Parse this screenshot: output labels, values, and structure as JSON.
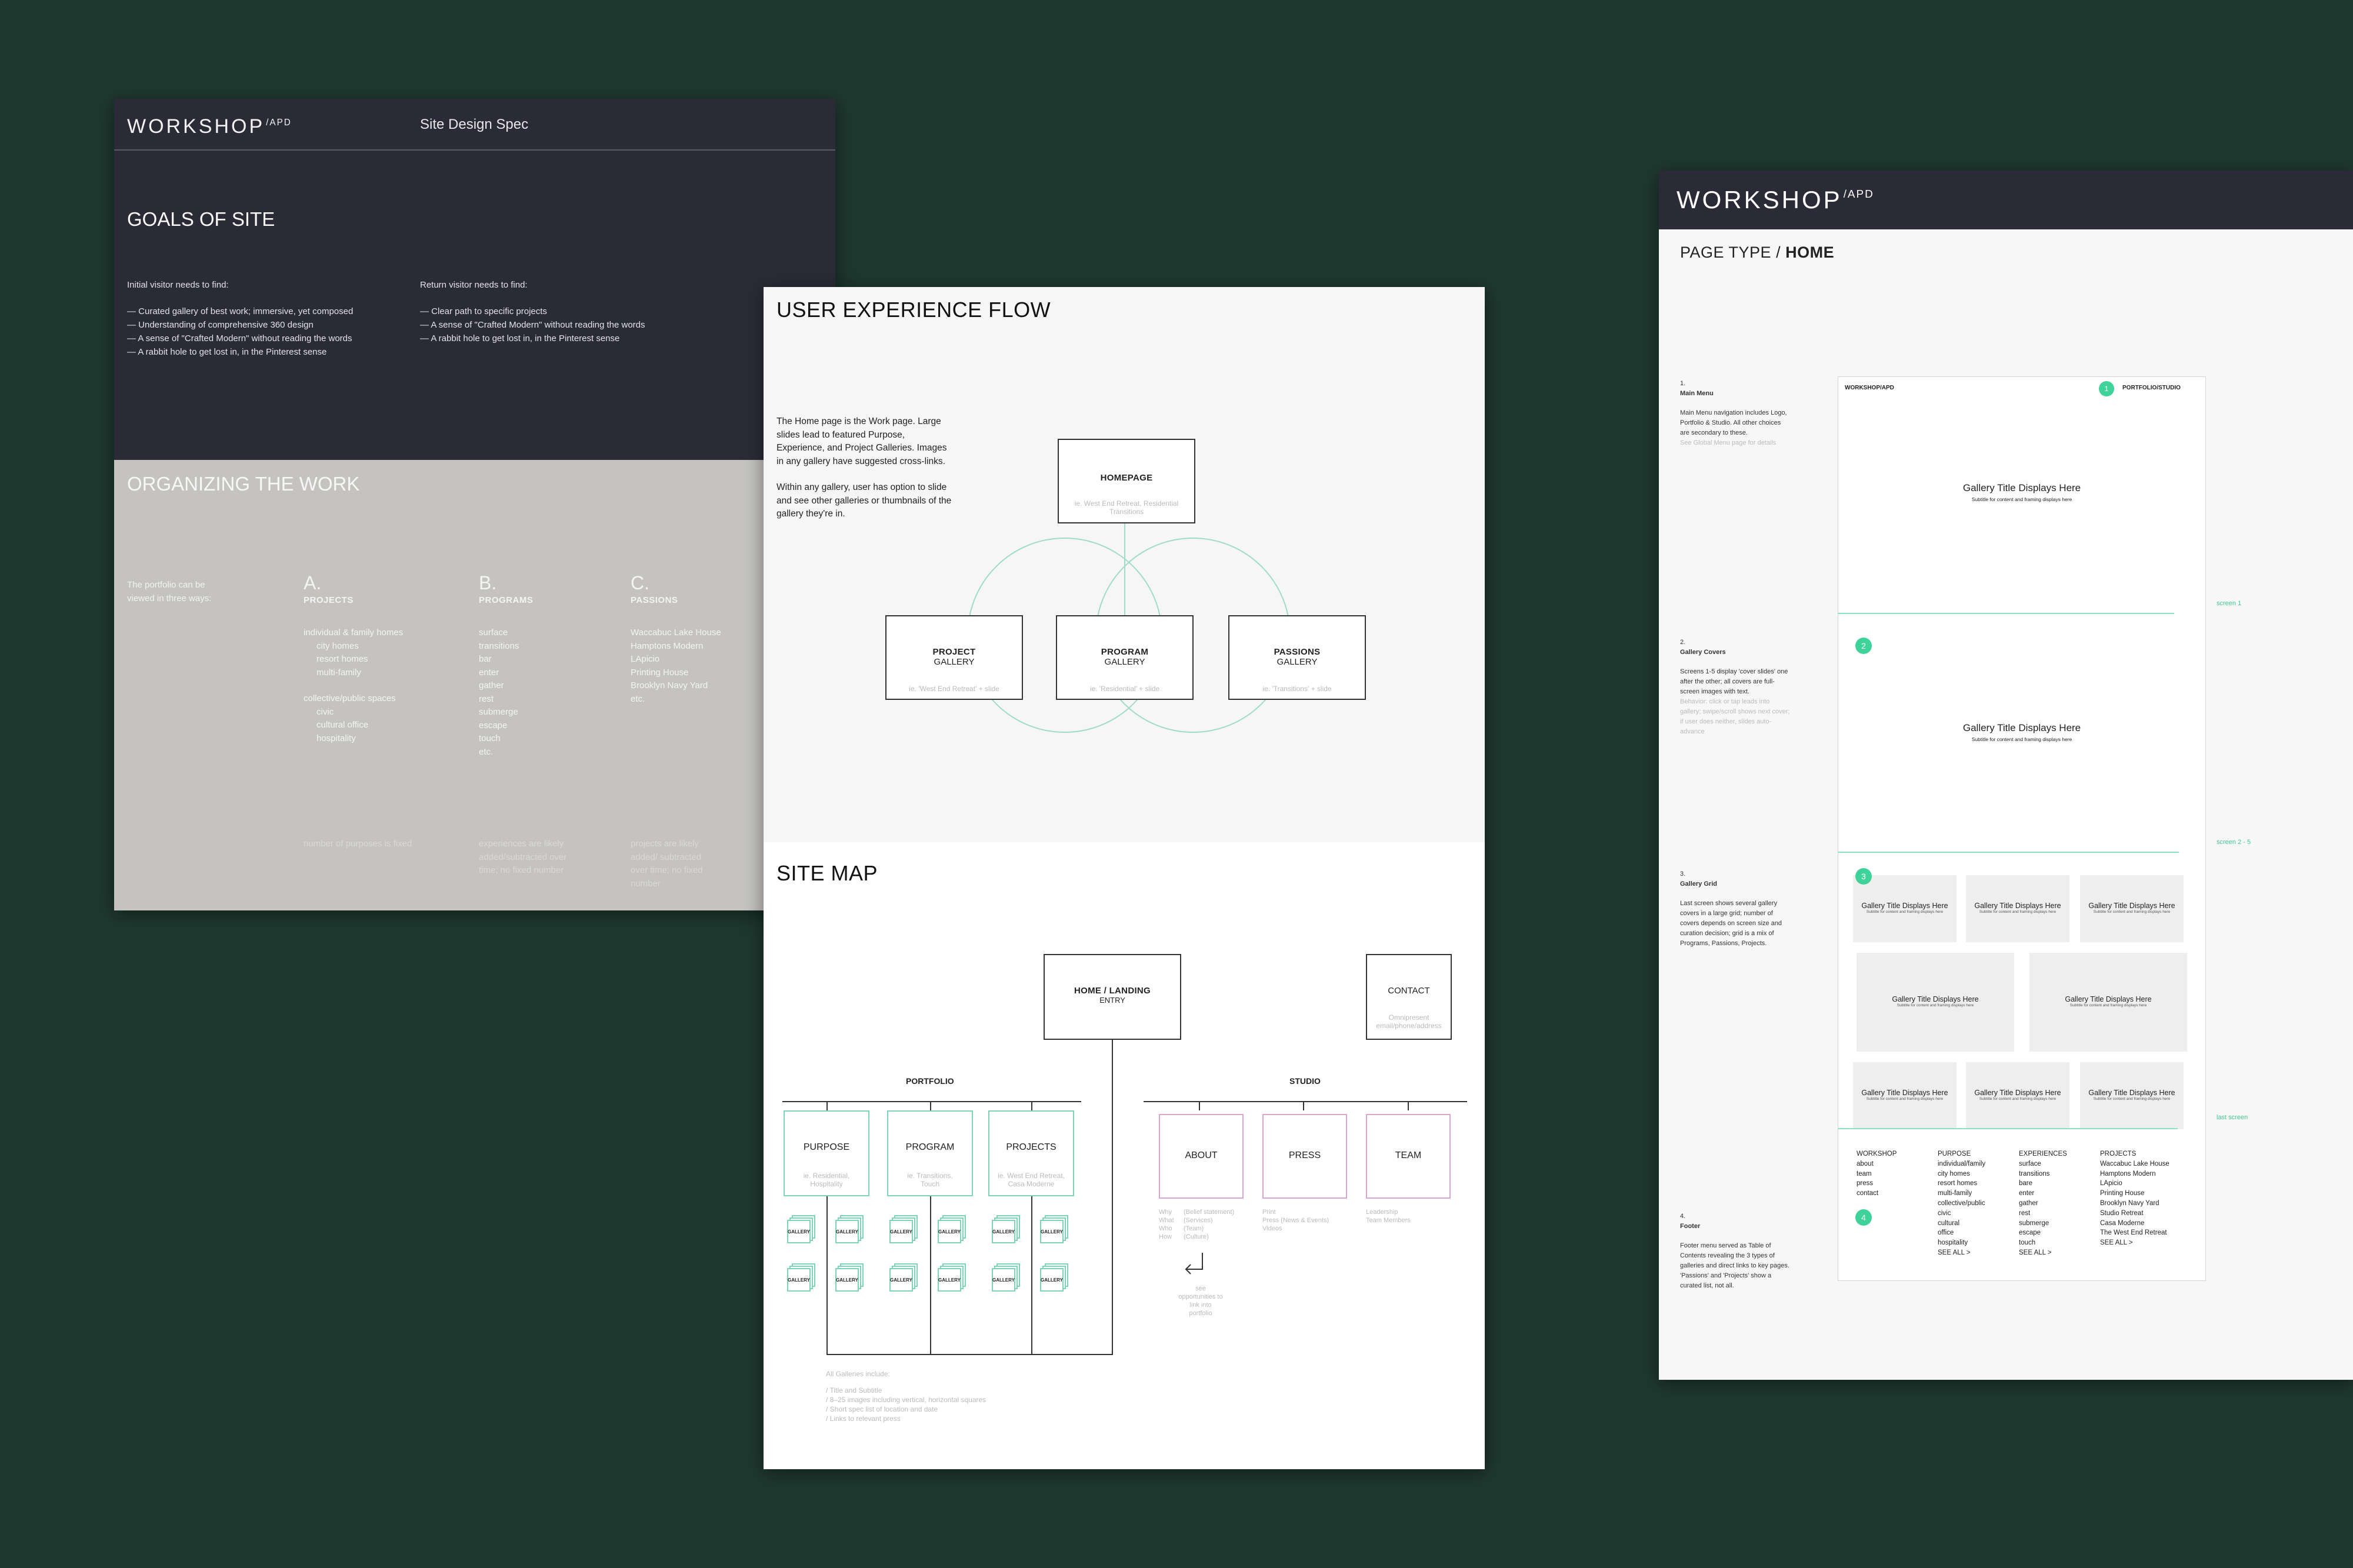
{
  "sheet1": {
    "logo": "WORKSHOP",
    "logo_sup": "/APD",
    "subtitle": "Site Design Spec",
    "goals_title": "GOALS OF SITE",
    "initial_head": "Initial visitor needs to find:",
    "initial_items": [
      "— Curated gallery of best work; immersive, yet composed",
      "— Understanding of comprehensive 360 design",
      "— A sense of \"Crafted Modern\" without reading the words",
      "— A rabbit hole to get lost in, in the Pinterest sense"
    ],
    "return_head": "Return visitor needs to find:",
    "return_items": [
      "— Clear path to specific projects",
      "— A sense of \"Crafted Modern\" without reading the words",
      "— A rabbit hole to get lost in, in the Pinterest sense"
    ],
    "org_title": "ORGANIZING THE WORK",
    "viewed": "The portfolio can be viewed in three ways:",
    "cat_a": {
      "letter": "A.",
      "title": "PROJECTS",
      "items": [
        "individual & family homes",
        "city homes",
        "resort homes",
        "multi-family",
        "collective/public spaces",
        "civic",
        "cultural office",
        "hospitality"
      ]
    },
    "cat_b": {
      "letter": "B.",
      "title": "PROGRAMS",
      "items": [
        "surface",
        "transitions",
        "bar",
        "enter",
        "gather",
        "rest",
        "submerge",
        "escape",
        "touch",
        "etc."
      ]
    },
    "cat_c": {
      "letter": "C.",
      "title": "PASSIONS",
      "items": [
        "Waccabuc Lake House",
        "Hamptons Modern",
        "LApicio",
        "Printing House",
        "Brooklyn Navy Yard",
        "etc."
      ]
    },
    "note_a": "number of purposes is fixed",
    "note_b": "experiences are likely added/subtracted over time; no fixed number",
    "note_c": "projects are likely added/ subtracted over time; no fixed number"
  },
  "sheet2": {
    "ux_title": "USER EXPERIENCE FLOW",
    "ux_p1": "The Home page is the Work page. Large slides lead to featured Purpose, Experience, and Project Galleries. Images in any gallery have suggested cross-links.",
    "ux_p2": "Within any gallery, user has option to slide and see other galleries or thumbnails of the gallery they're in.",
    "homepage": {
      "label": "HOMEPAGE",
      "sub": "ie. West End Retreat, Residential Transitions"
    },
    "project": {
      "l1": "PROJECT",
      "l2": "GALLERY",
      "sub": "ie. 'West End Retreat' + slide"
    },
    "program": {
      "l1": "PROGRAM",
      "l2": "GALLERY",
      "sub": "ie. 'Residential' + slide"
    },
    "passions": {
      "l1": "PASSIONS",
      "l2": "GALLERY",
      "sub": "ie. 'Transitions' + slide"
    },
    "sitemap_title": "SITE MAP",
    "home_landing": {
      "l1": "HOME / LANDING",
      "l2": "ENTRY"
    },
    "contact": {
      "label": "CONTACT",
      "sub": "Omnipresent email/phone/address"
    },
    "portfolio": "PORTFOLIO",
    "studio": "STUDIO",
    "purpose": {
      "label": "PURPOSE",
      "sub": "ie. Residential, Hospitality"
    },
    "program2": {
      "label": "PROGRAM",
      "sub": "ie. Transitions, Touch"
    },
    "projects": {
      "label": "PROJECTS",
      "sub": "ie. West End Retreat, Casa Moderne"
    },
    "about": "ABOUT",
    "press": "PRESS",
    "team": "TEAM",
    "about_left": "Why\nWhat\nWho\nHow",
    "about_right": "(Belief statement)\n(Services)\n(Team)\n(Culture)",
    "press_sub": "Print\nPress (News & Events)\nVideos",
    "team_sub": "Leadership\nTeam Members",
    "opp": "see\nopportunities to\nlink into\nportfolio",
    "gallery": "GALLERY",
    "galleries_head": "All Galleries include:",
    "galleries_items": [
      "/  Title and Subtitle",
      "/  8–25 images including vertical, horizontal squares",
      "/  Short spec list of location and date",
      "/  Links to relevant press"
    ]
  },
  "sheet3": {
    "logo": "WORKSHOP",
    "logo_sup": "/APD",
    "page_type": "PAGE TYPE",
    "page_type_value": "HOME",
    "s1": {
      "num": "1.",
      "title": "Main Menu",
      "text": "Main Menu navigation includes Logo, Portfolio & Studio. All other choices are secondary to these.",
      "grey": "See Global Menu page for details"
    },
    "s2": {
      "num": "2.",
      "title": "Gallery Covers",
      "text": "Screens 1-5 display 'cover slides' one after the other; all covers are full-screen images with text.",
      "grey": "Behavior: click or tap leads into gallery; swipe/scroll shows next cover; if user does neither, slides auto-advance"
    },
    "s3": {
      "num": "3.",
      "title": "Gallery Grid",
      "text": "Last screen shows several gallery covers in a large grid; number of covers depends on screen size and curation decision; grid is a mix of Programs, Passions, Projects."
    },
    "s4": {
      "num": "4.",
      "title": "Footer",
      "text": "Footer menu served as Table of Contents revealing the 3 types of galleries and direct links to key pages. 'Passions' and 'Projects' show a curated list, not all."
    },
    "mock_logo": "WORKSHOP/APD",
    "mock_menu": "PORTFOLIO/STUDIO",
    "gallery_title": "Gallery Title Displays Here",
    "gallery_sub": "Subtitle for content and framing displays here",
    "screen1": "screen 1",
    "screen25": "screen 2 - 5",
    "lastscreen": "last screen",
    "dot1": "1",
    "dot2": "2",
    "dot3": "3",
    "dot4": "4",
    "footer": {
      "workshop": [
        "WORKSHOP",
        "about",
        "team",
        "press",
        "contact"
      ],
      "purpose": [
        "PURPOSE",
        "individual/family",
        "city homes",
        "resort homes",
        "multi-family",
        "collective/public",
        "civic",
        "cultural",
        "office",
        "hospitality",
        "SEE ALL >"
      ],
      "experiences": [
        "EXPERIENCES",
        "surface",
        "transitions",
        "bare",
        "enter",
        "gather",
        "rest",
        "submerge",
        "escape",
        "touch",
        "SEE ALL >"
      ],
      "projects": [
        "PROJECTS",
        "Waccabuc Lake House",
        "Hamptons Modern",
        "LApicio",
        "Printing House",
        "Brooklyn Navy Yard",
        "Studio Retreat",
        "Casa Moderne",
        "The West End Retreat",
        "SEE ALL >"
      ]
    }
  }
}
